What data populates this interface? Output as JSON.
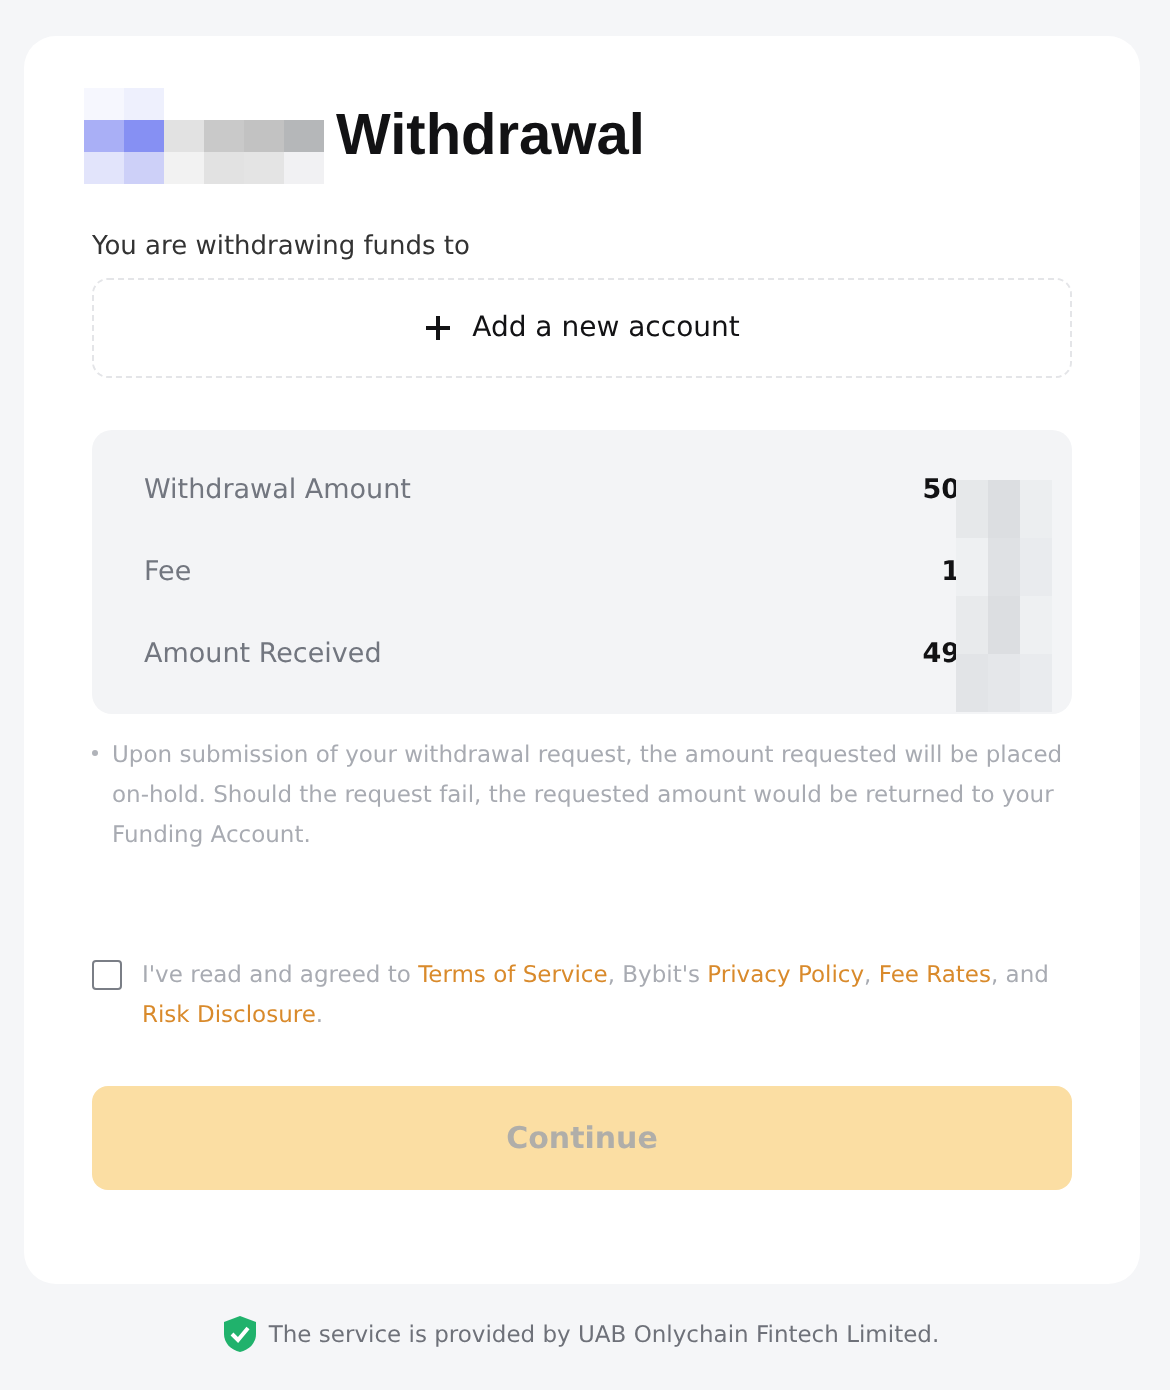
{
  "title": "Withdrawal",
  "destination": {
    "label": "You are withdrawing funds to",
    "add_button": "Add a new account"
  },
  "summary": [
    {
      "label": "Withdrawal Amount",
      "value": "50"
    },
    {
      "label": "Fee",
      "value": "1"
    },
    {
      "label": "Amount Received",
      "value": "49"
    }
  ],
  "notes": [
    "Upon submission of your withdrawal request, the amount requested will be placed on-hold. Should the request fail, the requested amount would be returned to your Funding Account."
  ],
  "agreement": {
    "checked": false,
    "parts": [
      {
        "kind": "text",
        "text": "I've read and agreed to "
      },
      {
        "kind": "link",
        "text": "Terms of Service"
      },
      {
        "kind": "text",
        "text": ", Bybit's "
      },
      {
        "kind": "link",
        "text": "Privacy Policy"
      },
      {
        "kind": "text",
        "text": ", "
      },
      {
        "kind": "link",
        "text": "Fee Rates"
      },
      {
        "kind": "text",
        "text": ", and "
      },
      {
        "kind": "link",
        "text": "Risk Disclosure"
      },
      {
        "kind": "text",
        "text": "."
      }
    ]
  },
  "continue_button": {
    "label": "Continue",
    "disabled": true
  },
  "footer": "The service is provided by UAB Onlychain Fintech Limited."
}
